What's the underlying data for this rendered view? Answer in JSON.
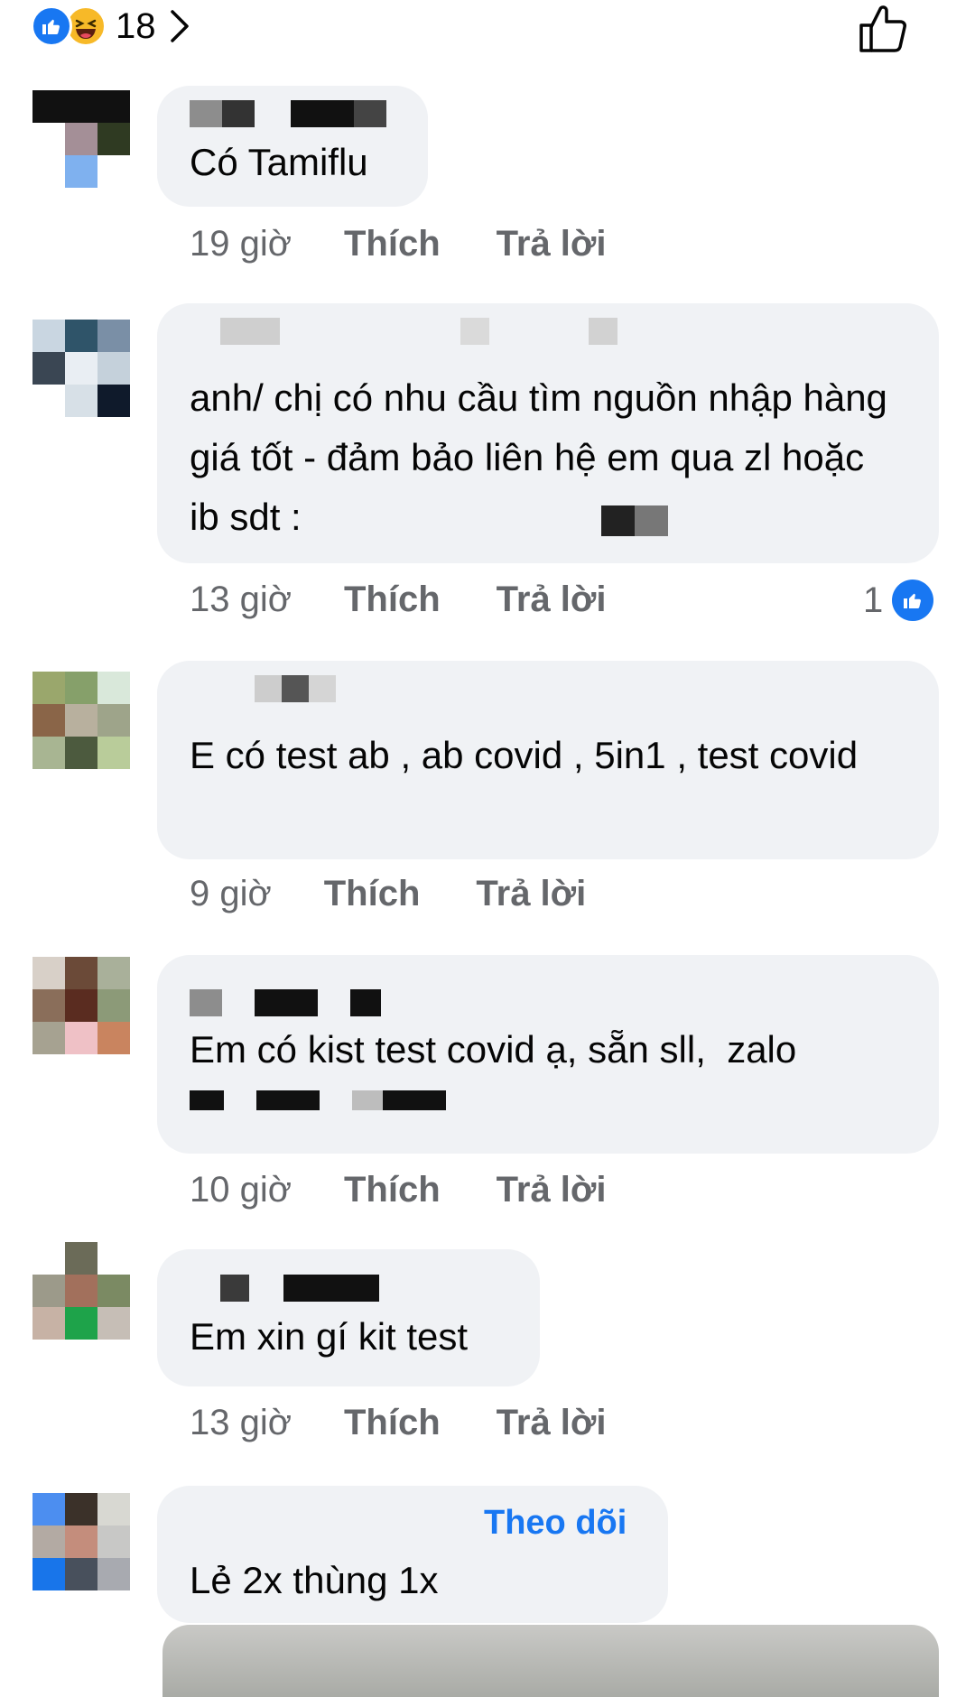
{
  "reactions": {
    "count": "18"
  },
  "comments": [
    {
      "text": "Có Tamiflu",
      "time": "19 giờ",
      "like": "Thích",
      "reply": "Trả lời"
    },
    {
      "text": "anh/ chị có nhu cầu tìm nguồn nhập hàng giá tốt - đảm bảo liên hệ em qua zl hoặc ib sdt :",
      "time": "13 giờ",
      "like": "Thích",
      "reply": "Trả lời",
      "like_count": "1"
    },
    {
      "text": "E có test ab , ab covid , 5in1 , test covid",
      "time": "9 giờ",
      "like": "Thích",
      "reply": "Trả lời"
    },
    {
      "text": "Em có kist test covid ạ, sẵn sll,  zalo",
      "time": "10 giờ",
      "like": "Thích",
      "reply": "Trả lời"
    },
    {
      "text": "Em xin gí kit test",
      "time": "13 giờ",
      "like": "Thích",
      "reply": "Trả lời"
    },
    {
      "text": "Lẻ 2x thùng 1x",
      "follow": "Theo dõi"
    }
  ],
  "colors": {
    "accent": "#1877f2",
    "bubble": "#f0f2f5",
    "meta": "#65676b"
  },
  "icons": {
    "reaction_like": "like-reaction-icon",
    "reaction_haha": "haha-reaction-icon",
    "chevron": "chevron-right-icon",
    "top_like": "thumbs-up-outline-icon"
  }
}
